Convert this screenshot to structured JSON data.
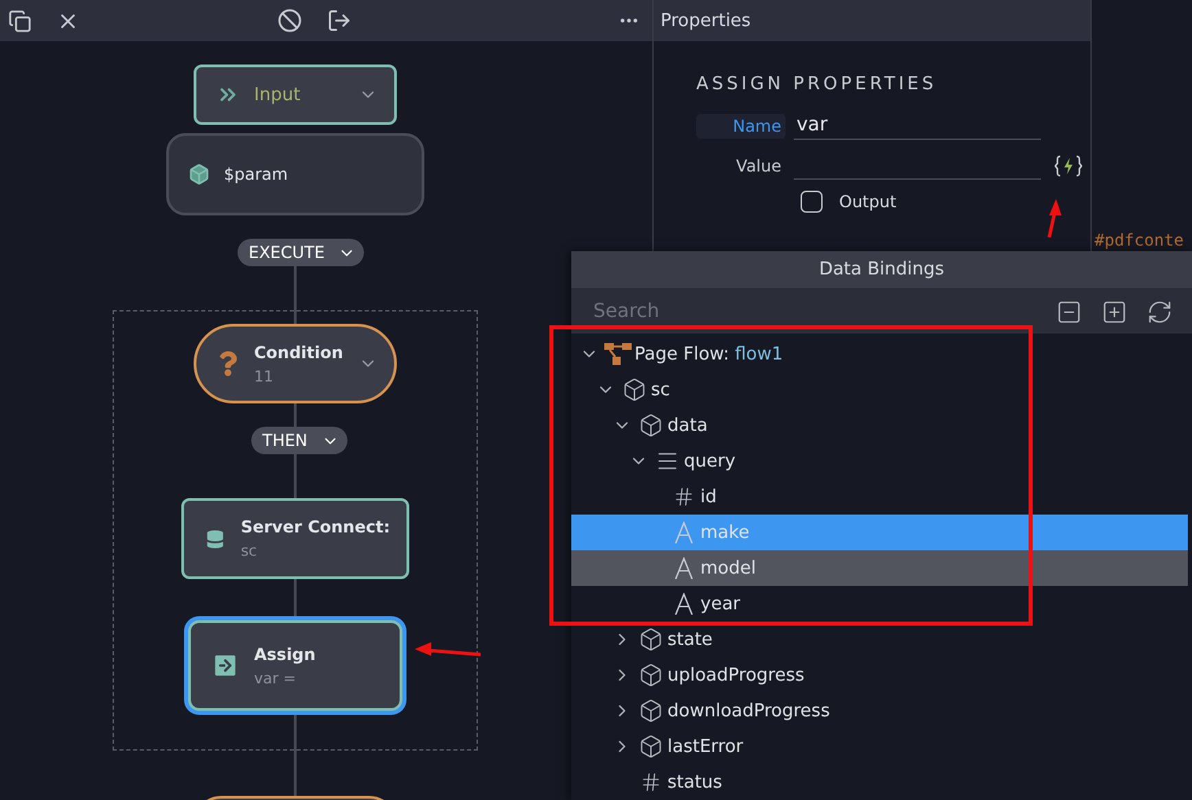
{
  "flow": {
    "nodes": [
      {
        "kind": "input",
        "title": "Input",
        "selected": false
      },
      {
        "kind": "param",
        "title": "$param",
        "selected": false
      },
      {
        "kind": "branch",
        "title": "EXECUTE",
        "selected": false
      },
      {
        "kind": "condition",
        "title": "Condition",
        "subtitle": "11",
        "selected": false
      },
      {
        "kind": "branch",
        "title": "THEN",
        "selected": false
      },
      {
        "kind": "server",
        "title": "Server Connect:",
        "subtitle": "sc",
        "selected": false
      },
      {
        "kind": "assign",
        "title": "Assign",
        "subtitle": "var =",
        "selected": true
      }
    ]
  },
  "properties": {
    "title": "Properties",
    "heading": "ASSIGN PROPERTIES",
    "fields": [
      {
        "label": "Name",
        "value": "var",
        "focused": true
      },
      {
        "label": "Value",
        "focused": false
      }
    ],
    "output": {
      "label": "Output",
      "checked": false
    }
  },
  "background_text": "#pdfconte",
  "data_bindings": {
    "title": "Data Bindings",
    "search": {
      "placeholder": "Search"
    },
    "tree": [
      {
        "label": "Page Flow:",
        "value": "flow1",
        "kind": "flow",
        "expanded": true,
        "selected": false,
        "highlighted": false,
        "children": [
          {
            "label": "sc",
            "kind": "object",
            "expanded": true,
            "selected": false,
            "highlighted": false,
            "children": [
              {
                "label": "data",
                "kind": "object",
                "expanded": true,
                "selected": false,
                "highlighted": false,
                "children": [
                  {
                    "label": "query",
                    "kind": "array",
                    "expanded": true,
                    "selected": false,
                    "highlighted": false,
                    "children": [
                      {
                        "label": "id",
                        "kind": "number",
                        "selected": false,
                        "highlighted": false
                      },
                      {
                        "label": "make",
                        "kind": "string",
                        "selected": true,
                        "highlighted": false
                      },
                      {
                        "label": "model",
                        "kind": "string",
                        "selected": false,
                        "highlighted": true
                      },
                      {
                        "label": "year",
                        "kind": "string",
                        "selected": false,
                        "highlighted": false
                      }
                    ]
                  }
                ]
              },
              {
                "label": "state",
                "kind": "object",
                "expanded": false,
                "selected": false,
                "highlighted": false
              },
              {
                "label": "uploadProgress",
                "kind": "object",
                "expanded": false,
                "selected": false,
                "highlighted": false
              },
              {
                "label": "downloadProgress",
                "kind": "object",
                "expanded": false,
                "selected": false,
                "highlighted": false
              },
              {
                "label": "lastError",
                "kind": "object",
                "expanded": false,
                "selected": false,
                "highlighted": false
              },
              {
                "label": "status",
                "kind": "number",
                "selected": false,
                "highlighted": false
              }
            ]
          }
        ]
      }
    ]
  }
}
